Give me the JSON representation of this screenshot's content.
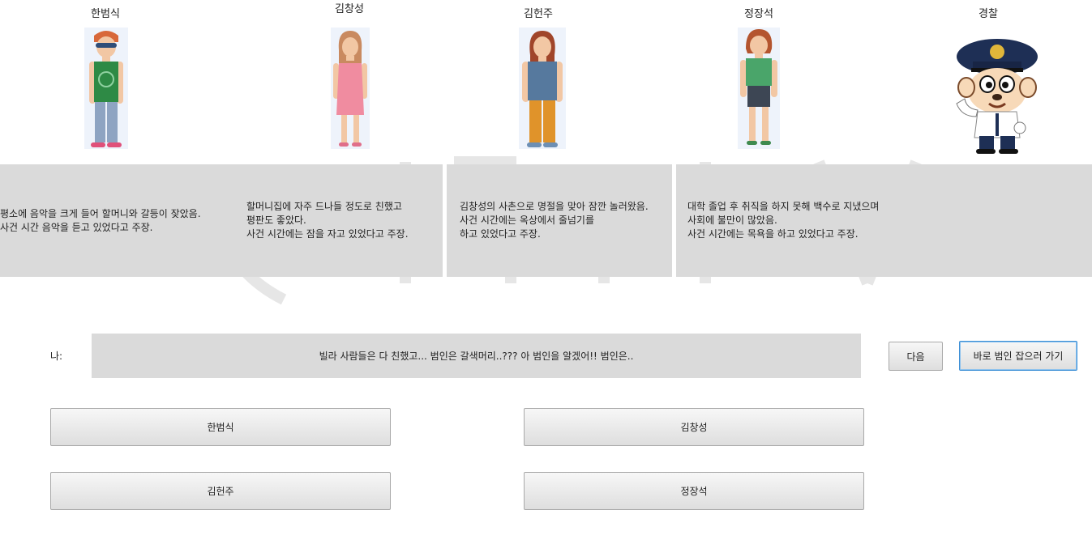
{
  "characters": [
    {
      "name": "한범식"
    },
    {
      "name": "김창성"
    },
    {
      "name": "김헌주"
    },
    {
      "name": "정장석"
    },
    {
      "name": "경찰"
    }
  ],
  "descriptions": [
    {
      "text": "평소에 음악을 크게 들어 할머니와 갈등이 잦았음.\n사건 시간 음악을 듣고 있었다고 주장."
    },
    {
      "text": "할머니집에 자주 드나들 정도로 친했고\n평판도 좋았다.\n사건 시간에는 잠을 자고 있었다고 주장."
    },
    {
      "text": "김창성의 사촌으로 명절을 맞아 잠깐 놀러왔음.\n사건 시간에는 옥상에서 줄넘기를\n하고 있었다고 주장."
    },
    {
      "text": "대학 졸업 후 취직을 하지 못해 백수로 지냈으며\n사회에 불만이 많았음.\n사건 시간에는 목욕을 하고 있었다고 주장."
    }
  ],
  "dialog": {
    "speaker": "나:",
    "text": "빌라 사람들은 다 친했고... 범인은 갈색머리..??? 아 범인을 알겠어!! 범인은.."
  },
  "buttons": {
    "next": "다음",
    "catch_now": "바로 범인 잡으러 가기"
  },
  "choices": [
    "한범식",
    "김창성",
    "김헌주",
    "정장석"
  ]
}
